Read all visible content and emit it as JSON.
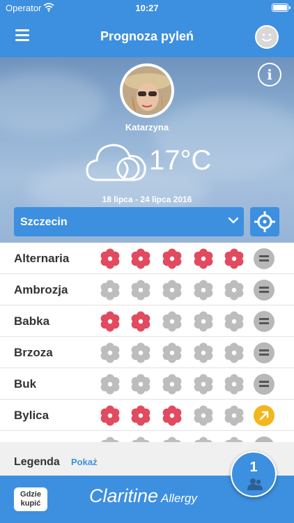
{
  "status_bar": {
    "carrier": "Operator",
    "time": "10:27"
  },
  "nav": {
    "title": "Prognoza pyleń"
  },
  "profile": {
    "name": "Katarzyna"
  },
  "weather": {
    "temperature": "17°C",
    "date_range": "18 lipca - 24 lipca 2016"
  },
  "location": {
    "city": "Szczecin"
  },
  "colors": {
    "accent": "#3d8fe0",
    "pollen_active": "#e24a5f",
    "pollen_inactive": "#bdbdbd",
    "trend_up": "#f2b71e",
    "trend_steady": "#b8b8b8"
  },
  "pollen": [
    {
      "name": "Alternaria",
      "level": 5,
      "trend": "steady"
    },
    {
      "name": "Ambrozja",
      "level": 0,
      "trend": "steady"
    },
    {
      "name": "Babka",
      "level": 2,
      "trend": "steady"
    },
    {
      "name": "Brzoza",
      "level": 0,
      "trend": "steady"
    },
    {
      "name": "Buk",
      "level": 0,
      "trend": "steady"
    },
    {
      "name": "Bylica",
      "level": 3,
      "trend": "up"
    },
    {
      "name": "",
      "level": 0,
      "trend": "steady"
    }
  ],
  "legend": {
    "title": "Legenda",
    "link": "Pokaż"
  },
  "footer": {
    "buy_label_line1": "Gdzie",
    "buy_label_line2": "kupić",
    "brand": "Claritine",
    "brand_sub": "Allergy"
  },
  "fab": {
    "count": "1"
  },
  "icons": {
    "menu": "menu-icon",
    "profile": "smiley-icon",
    "info": "info-icon",
    "weather": "cloud-moon-icon",
    "locate": "crosshair-icon",
    "flower": "flower-icon",
    "fab": "people-icon"
  }
}
